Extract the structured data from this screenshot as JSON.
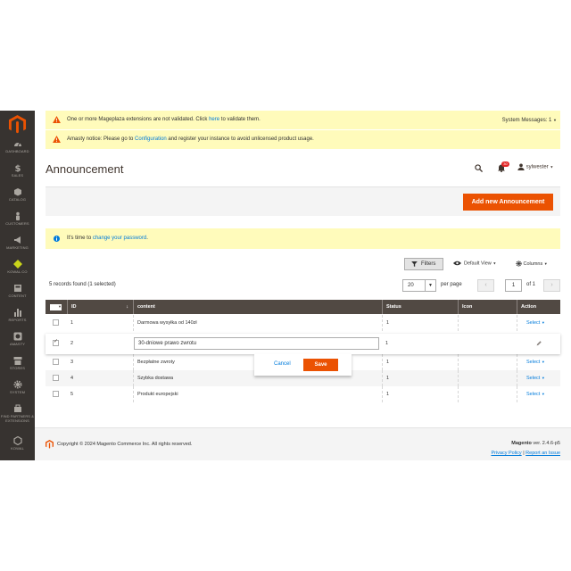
{
  "sidebar": {
    "items": [
      {
        "label": "DASHBOARD",
        "icon": "dashboard-icon"
      },
      {
        "label": "SALES",
        "icon": "dollar-icon"
      },
      {
        "label": "CATALOG",
        "icon": "box-icon"
      },
      {
        "label": "CUSTOMERS",
        "icon": "person-icon"
      },
      {
        "label": "MARKETING",
        "icon": "megaphone-icon"
      },
      {
        "label": "KOWAL.CO",
        "icon": "diamond-icon"
      },
      {
        "label": "CONTENT",
        "icon": "content-icon"
      },
      {
        "label": "REPORTS",
        "icon": "bar-chart-icon"
      },
      {
        "label": "AMASTY",
        "icon": "amasty-icon"
      },
      {
        "label": "STORES",
        "icon": "store-icon"
      },
      {
        "label": "SYSTEM",
        "icon": "gear-icon"
      },
      {
        "label": "FIND PARTNERS & EXTENSIONS",
        "icon": "partners-icon"
      },
      {
        "label": "KOWAL",
        "icon": "hexagon-icon"
      }
    ]
  },
  "messages": {
    "mageplaza_pre": "One or more Mageplaza extensions are not validated. Click ",
    "mageplaza_link": "here",
    "mageplaza_post": " to validate them.",
    "system_messages": "System Messages: 1",
    "amasty_pre": "Amasty notice: Please go to ",
    "amasty_link": "Configuration",
    "amasty_post": " and register your instance to avoid unlicensed product usage."
  },
  "header": {
    "title": "Announcement",
    "notifications_count": "30",
    "user": "sylwester"
  },
  "actions": {
    "add_new": "Add new Announcement"
  },
  "notice": {
    "pre": "It's time to ",
    "link": "change your password",
    "post": "."
  },
  "toolbar": {
    "filters": "Filters",
    "default_view": "Default View",
    "columns": "Columns",
    "records_found": "5 records found (1 selected)",
    "per_page_value": "20",
    "per_page_label": "per page",
    "page_current": "1",
    "page_of": "of 1"
  },
  "grid": {
    "columns": [
      "ID",
      "content",
      "Status",
      "Icon",
      "Action"
    ],
    "rows": [
      {
        "id": "1",
        "content": "Darmowa wysyłka od 140zł",
        "status": "1",
        "action": "Select"
      },
      {
        "id": "2",
        "content": "30-dniowe prawo zwrotu",
        "status": "1",
        "action": ""
      },
      {
        "id": "3",
        "content": "Bezpłatne zwroty",
        "status": "1",
        "action": "Select"
      },
      {
        "id": "4",
        "content": "Szybka dostawa",
        "status": "1",
        "action": "Select"
      },
      {
        "id": "5",
        "content": "Produkt europejski",
        "status": "1",
        "action": "Select"
      }
    ],
    "inline_edit": {
      "cancel": "Cancel",
      "save": "Save"
    }
  },
  "footer": {
    "copyright": "Copyright © 2024 Magento Commerce Inc. All rights reserved.",
    "brand": "Magento",
    "version": " ver. 2.4.6-p5",
    "privacy": "Privacy Policy",
    "separator": " | ",
    "report": "Report an Issue"
  },
  "colors": {
    "sidebar": "#373330",
    "accent": "#eb5202",
    "link": "#007bdb",
    "grid_header": "#514943",
    "notice": "#fffbbb"
  }
}
